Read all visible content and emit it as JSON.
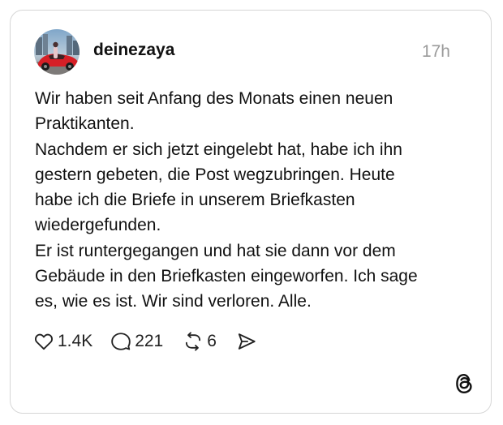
{
  "post": {
    "author": {
      "username": "deinezaya",
      "avatar_icon": "avatar-photo-red-sports-car"
    },
    "time_ago": "17h",
    "text_lines": [
      "Wir haben seit Anfang des Monats einen neuen",
      "Praktikanten.",
      "Nachdem er sich jetzt eingelebt hat, habe ich ihn",
      "gestern gebeten, die Post wegzubringen. Heute",
      "habe ich die Briefe in unserem Briefkasten",
      "wiedergefunden.",
      "Er ist runtergegangen und hat sie dann vor dem",
      "Gebäude in den Briefkasten eingeworfen. Ich sage",
      "es, wie es ist. Wir sind verloren. Alle."
    ],
    "stats": {
      "likes": "1.4K",
      "replies": "221",
      "reposts": "6"
    }
  },
  "icons": {
    "like": "heart-icon",
    "reply": "speech-bubble-icon",
    "repost": "repost-arrows-icon",
    "share": "send-icon",
    "brand": "threads-logo-icon"
  },
  "colors": {
    "text": "#111111",
    "muted": "#9a9a9a",
    "border": "#d6d6d6",
    "avatar_car": "#d61f26"
  }
}
